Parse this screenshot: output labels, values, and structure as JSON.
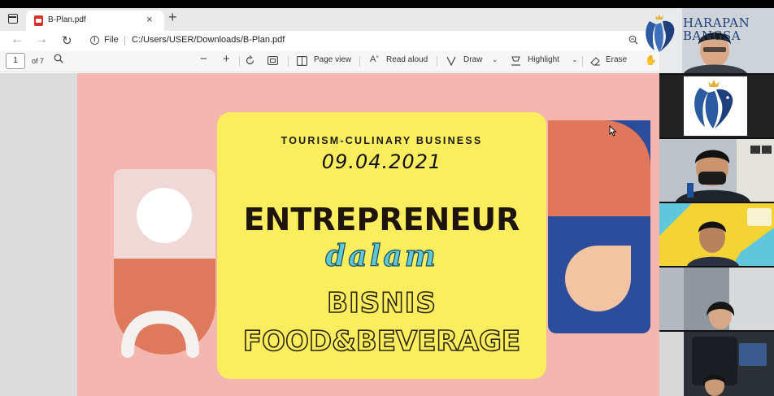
{
  "browser": {
    "tab_title": "B-Plan.pdf",
    "tab_close": "×",
    "new_tab": "+",
    "nav_back": "←",
    "nav_forward": "→",
    "nav_reload": "↻",
    "file_label": "File",
    "url": "C:/Users/USER/Downloads/B-Plan.pdf",
    "zoom_icon": "search-minus-icon"
  },
  "pdf_toolbar": {
    "page_current": "1",
    "page_total": "of 7",
    "zoom_out": "−",
    "zoom_in": "+",
    "page_view": "Page view",
    "read_aloud": "Read aloud",
    "draw": "Draw",
    "highlight": "Highlight",
    "erase": "Erase"
  },
  "slide": {
    "subtitle": "TOURISM-CULINARY BUSINESS",
    "date": "09.04.2021",
    "title": "ENTREPRENEUR",
    "connector": "dalam",
    "line3": "BISNIS",
    "line4": "FOOD&BEVERAGE",
    "colors": {
      "background": "#f4b7b0",
      "card": "#fbee5e",
      "orange": "#e0765a",
      "navy": "#2b4d9c",
      "teal_script": "#5ec8d6"
    }
  },
  "sidebar": {
    "brand_name": "HARAPAN BANGSA",
    "participants": [
      {
        "tile": "presenter-video"
      },
      {
        "tile": "school-logo"
      },
      {
        "tile": "participant-masked"
      },
      {
        "tile": "participant-yellow-bg"
      },
      {
        "tile": "participant-child"
      },
      {
        "tile": "participant-office"
      }
    ]
  }
}
